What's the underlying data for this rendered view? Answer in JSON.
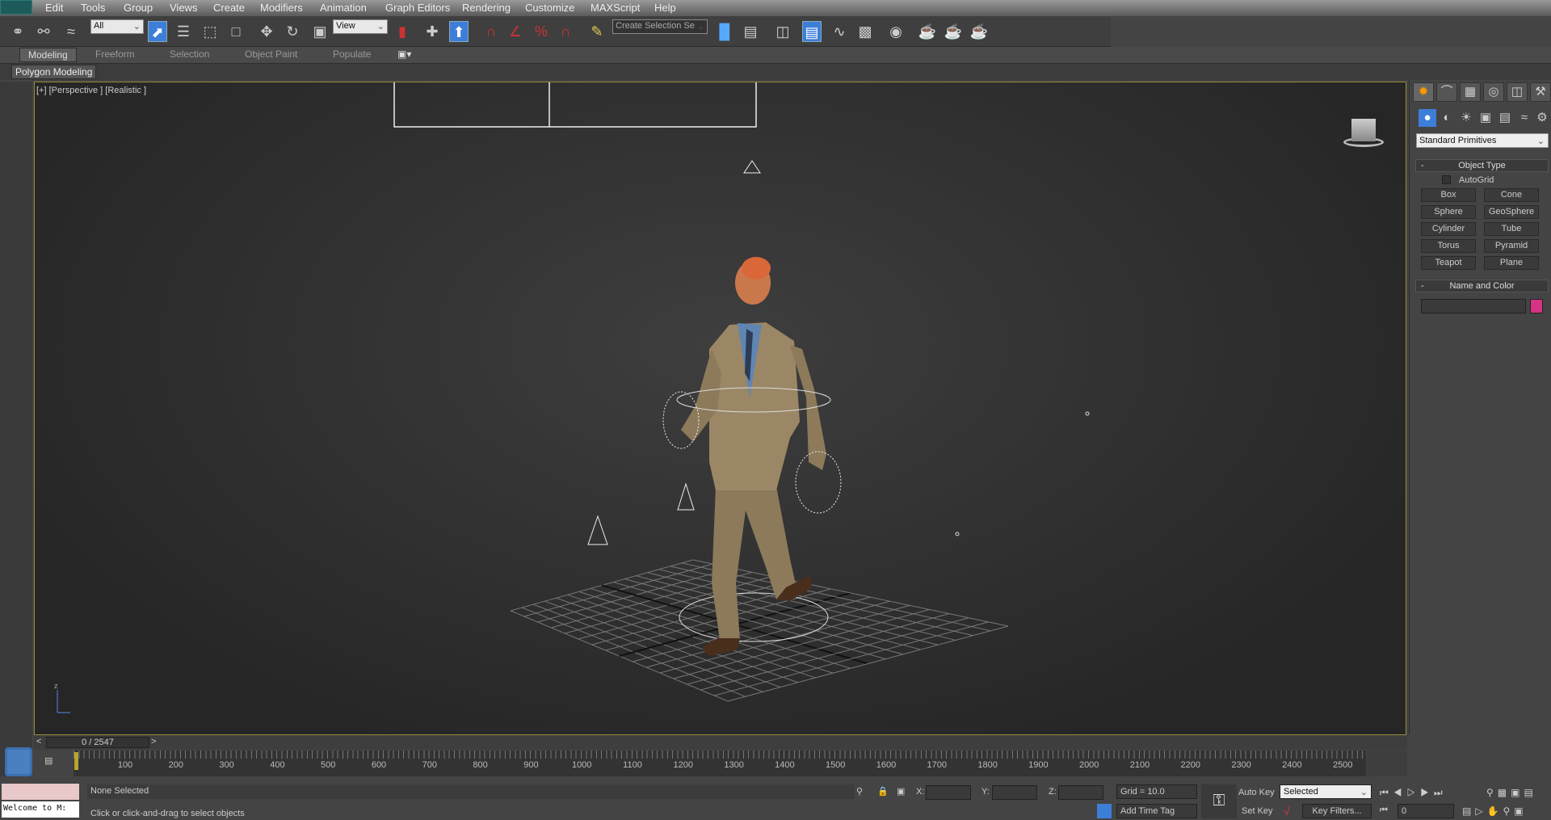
{
  "menu": [
    "Edit",
    "Tools",
    "Group",
    "Views",
    "Create",
    "Modifiers",
    "Animation",
    "Graph Editors",
    "Rendering",
    "Customize",
    "MAXScript",
    "Help"
  ],
  "toolbar": {
    "selection_filter": "All",
    "ref_coord": "View",
    "named_selection": "Create Selection Se"
  },
  "ribbon": {
    "tabs": [
      "Modeling",
      "Freeform",
      "Selection",
      "Object Paint",
      "Populate"
    ],
    "active": "Modeling",
    "panel": "Polygon Modeling"
  },
  "viewport": {
    "label": "[+] [Perspective ] [Realistic ]"
  },
  "command_panel": {
    "category": "Standard Primitives",
    "object_type_title": "Object Type",
    "autogrid": "AutoGrid",
    "primitives": [
      "Box",
      "Cone",
      "Sphere",
      "GeoSphere",
      "Cylinder",
      "Tube",
      "Torus",
      "Pyramid",
      "Teapot",
      "Plane"
    ],
    "name_color_title": "Name and Color",
    "object_color": "#d63384"
  },
  "timeline": {
    "slider": "0 / 2547",
    "ticks": [
      "100",
      "200",
      "300",
      "400",
      "500",
      "600",
      "700",
      "800",
      "900",
      "1000",
      "1100",
      "1200",
      "1300",
      "1400",
      "1500",
      "1600",
      "1700",
      "1800",
      "1900",
      "2000",
      "2100",
      "2200",
      "2300",
      "2400",
      "2500"
    ],
    "current": "0"
  },
  "status": {
    "maxscript": "Welcome to M:",
    "selection": "None Selected",
    "prompt": "Click or click-and-drag to select objects",
    "x_label": "X:",
    "y_label": "Y:",
    "z_label": "Z:",
    "grid": "Grid = 10.0",
    "add_time_tag": "Add Time Tag",
    "auto_key": "Auto Key",
    "set_key": "Set Key",
    "key_mode": "Selected",
    "key_filters": "Key Filters...",
    "frame": "0"
  }
}
